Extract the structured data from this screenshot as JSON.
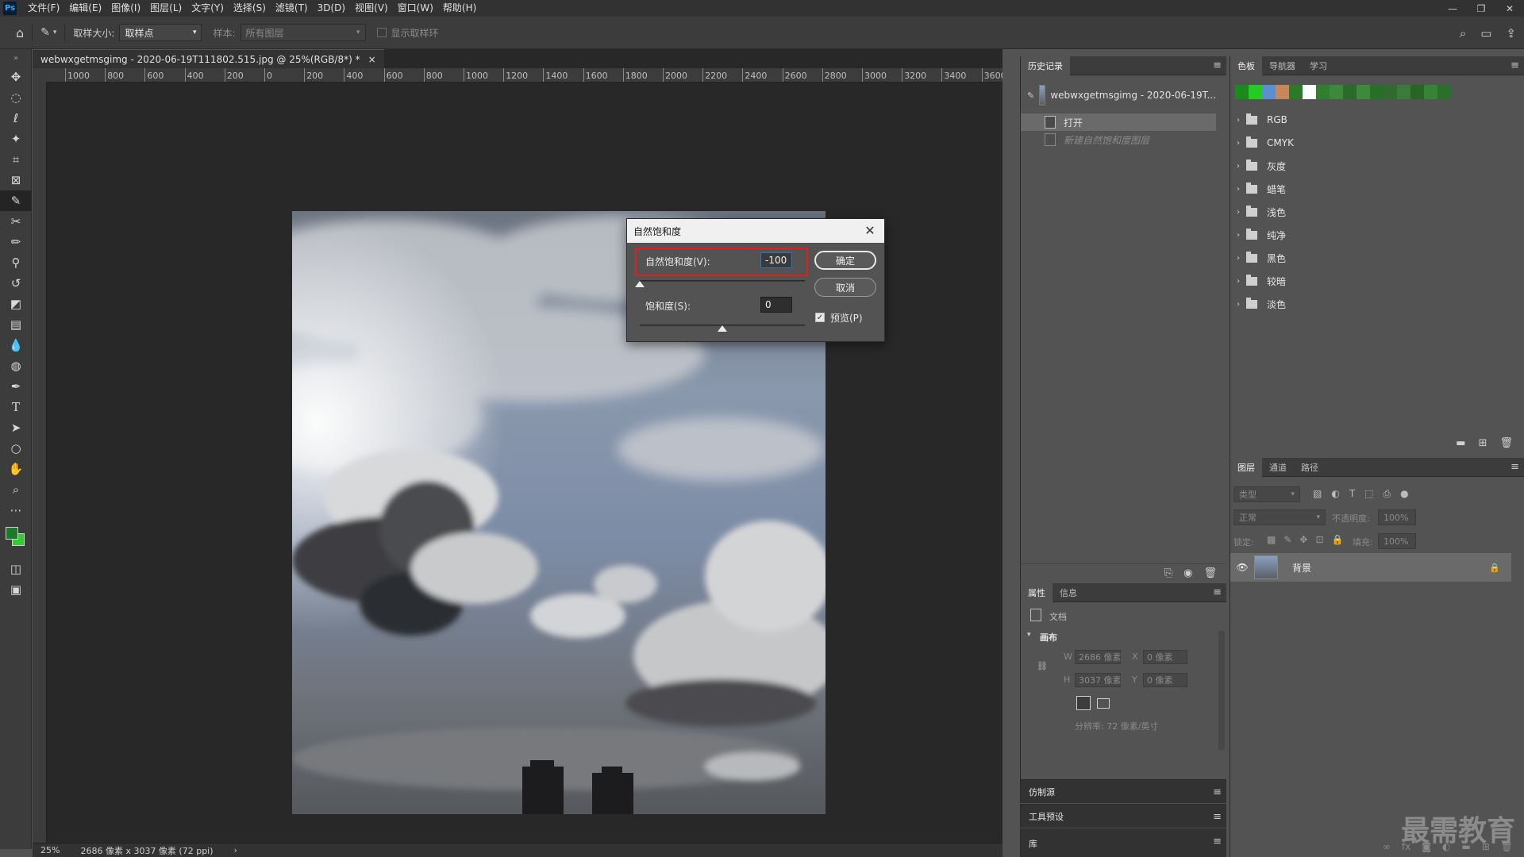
{
  "app": {
    "logo": "Ps",
    "menu": [
      "文件(F)",
      "编辑(E)",
      "图像(I)",
      "图层(L)",
      "文字(Y)",
      "选择(S)",
      "滤镜(T)",
      "3D(D)",
      "视图(V)",
      "窗口(W)",
      "帮助(H)"
    ]
  },
  "options": {
    "sample_size_label": "取样大小:",
    "sample_size_value": "取样点",
    "sample_label": "样本:",
    "sample_value": "所有图层",
    "show_ring_label": "显示取样环"
  },
  "document": {
    "tab_title": "webwxgetmsgimg - 2020-06-19T111802.515.jpg @ 25%(RGB/8*) *",
    "tab_close": "×",
    "ruler_ticks": [
      "1000",
      "800",
      "600",
      "400",
      "200",
      "0",
      "200",
      "400",
      "600",
      "800",
      "1000",
      "1200",
      "1400",
      "1600",
      "1800",
      "2000",
      "2200",
      "2400",
      "2600",
      "2800",
      "3000",
      "3200",
      "3400",
      "3600"
    ],
    "zoom": "25%",
    "size_info": "2686 像素 x 3037 像素 (72 ppi)"
  },
  "dialog": {
    "title": "自然饱和度",
    "vibrance_label": "自然饱和度(V):",
    "vibrance_value": "-100",
    "saturation_label": "饱和度(S):",
    "saturation_value": "0",
    "vibrance_level_fraction": 0.0,
    "saturation_level_fraction": 0.5,
    "ok": "确定",
    "cancel": "取消",
    "preview": "预览(P)",
    "preview_checked": true
  },
  "history": {
    "tab": "历史记录",
    "snapshot": "webwxgetmsgimg - 2020-06-19T...",
    "items": [
      {
        "label": "打开",
        "state": "selected"
      },
      {
        "label": "新建自然饱和度图层",
        "state": "disabled"
      }
    ]
  },
  "properties": {
    "tabs": [
      "属性",
      "信息"
    ],
    "doc_label": "文档",
    "canvas_label": "画布",
    "w_label": "W",
    "h_label": "H",
    "x_label": "X",
    "y_label": "Y",
    "w_value": "2686 像素",
    "h_value": "3037 像素",
    "x_value": "0 像素",
    "y_value": "0 像素",
    "resolution": "分辨率: 72 像素/英寸"
  },
  "collapsed_panels": [
    "仿制源",
    "工具预设",
    "库"
  ],
  "swatches": {
    "tabs": [
      "色板",
      "导航器",
      "学习"
    ],
    "colors": [
      "#1a8a1a",
      "#22cc22",
      "#5a8fd0",
      "#c8875a",
      "#2a7a2a",
      "#ffffff",
      "#2f7f2f",
      "#3a8a3a",
      "#2a6a2a",
      "#3b8b3b",
      "#276f27",
      "#2f6a2f",
      "#3a7a3a",
      "#266526",
      "#358535",
      "#2a702a"
    ],
    "groups": [
      "RGB",
      "CMYK",
      "灰度",
      "蜡笔",
      "浅色",
      "纯净",
      "黑色",
      "较暗",
      "淡色"
    ]
  },
  "layers": {
    "tabs": [
      "图层",
      "通道",
      "路径"
    ],
    "filter_placeholder": "类型",
    "blend_mode": "正常",
    "opacity_label": "不透明度:",
    "opacity_value": "100%",
    "lock_label": "锁定:",
    "fill_label": "填充:",
    "fill_value": "100%",
    "layer_name": "背景"
  },
  "colors": {
    "foreground": "#1d7a2a",
    "background": "#33cc33",
    "alert_border": "#e02020"
  },
  "watermark": "最需教育"
}
